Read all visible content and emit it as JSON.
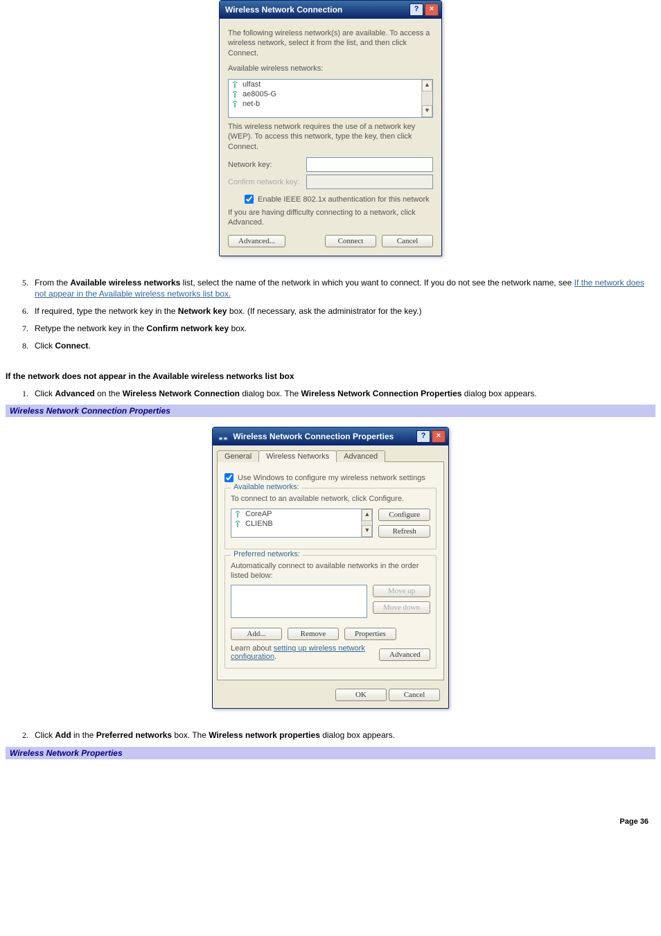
{
  "dlg1": {
    "title": "Wireless Network Connection",
    "intro": "The following wireless network(s) are available. To access a wireless network, select it from the list, and then click Connect.",
    "available_label": "Available wireless networks:",
    "networks": [
      "ulfast",
      "ae8005-G",
      "net-b"
    ],
    "wep_text": "This wireless network requires the use of a network key (WEP). To access this network, type the key, then click Connect.",
    "netkey_label": "Network key:",
    "confirm_label": "Confirm network key:",
    "enable_8021x": "Enable IEEE 802.1x authentication for this network",
    "difficulty": "If you are having difficulty connecting to a network, click Advanced.",
    "btn_advanced": "Advanced...",
    "btn_connect": "Connect",
    "btn_cancel": "Cancel"
  },
  "steps1": {
    "s5a": "From the ",
    "s5_bold": "Available wireless networks",
    "s5b": " list, select the name of the network in which you want to connect. If you do not see the network name, see ",
    "s5_link": "If the network does not appear in the Available wireless networks list box.",
    "s6a": "If required, type the network key in the ",
    "s6_bold": "Network key",
    "s6b": " box. (If necessary, ask the administrator for the key.)",
    "s7a": "Retype the network key in the ",
    "s7_bold": "Confirm network key",
    "s7b": " box.",
    "s8a": "Click ",
    "s8_bold": "Connect",
    "s8b": "."
  },
  "sub1": "If the network does not appear in the Available wireless networks list box",
  "steps2": {
    "s1a": "Click ",
    "s1_b1": "Advanced",
    "s1b": " on the ",
    "s1_b2": "Wireless Network Connection",
    "s1c": " dialog box. The ",
    "s1_b3": "Wireless Network Connection Properties",
    "s1d": " dialog box appears."
  },
  "bar1": "Wireless Network Connection Properties",
  "dlg2": {
    "title": "Wireless Network Connection Properties",
    "tabs": [
      "General",
      "Wireless Networks",
      "Advanced"
    ],
    "use_windows": "Use Windows to configure my wireless network settings",
    "grp_avail_title": "Available networks:",
    "grp_avail_instr": "To connect to an available network, click Configure.",
    "avail_nets": [
      "CoreAP",
      "CLIENB"
    ],
    "btn_configure": "Configure",
    "btn_refresh": "Refresh",
    "grp_pref_title": "Preferred networks:",
    "grp_pref_instr": "Automatically connect to available networks in the order listed below:",
    "btn_moveup": "Move up",
    "btn_movedown": "Move down",
    "btn_add": "Add...",
    "btn_remove": "Remove",
    "btn_properties": "Properties",
    "learn_a": "Learn about ",
    "learn_link": "setting up wireless network configuration",
    "btn_advanced": "Advanced",
    "btn_ok": "OK",
    "btn_cancel": "Cancel"
  },
  "steps3": {
    "s2a": "Click ",
    "s2_b1": "Add",
    "s2b": " in the ",
    "s2_b2": "Preferred networks",
    "s2c": " box. The ",
    "s2_b3": "Wireless network properties",
    "s2d": " dialog box appears."
  },
  "bar2": "Wireless Network Properties",
  "page_num": "Page 36"
}
